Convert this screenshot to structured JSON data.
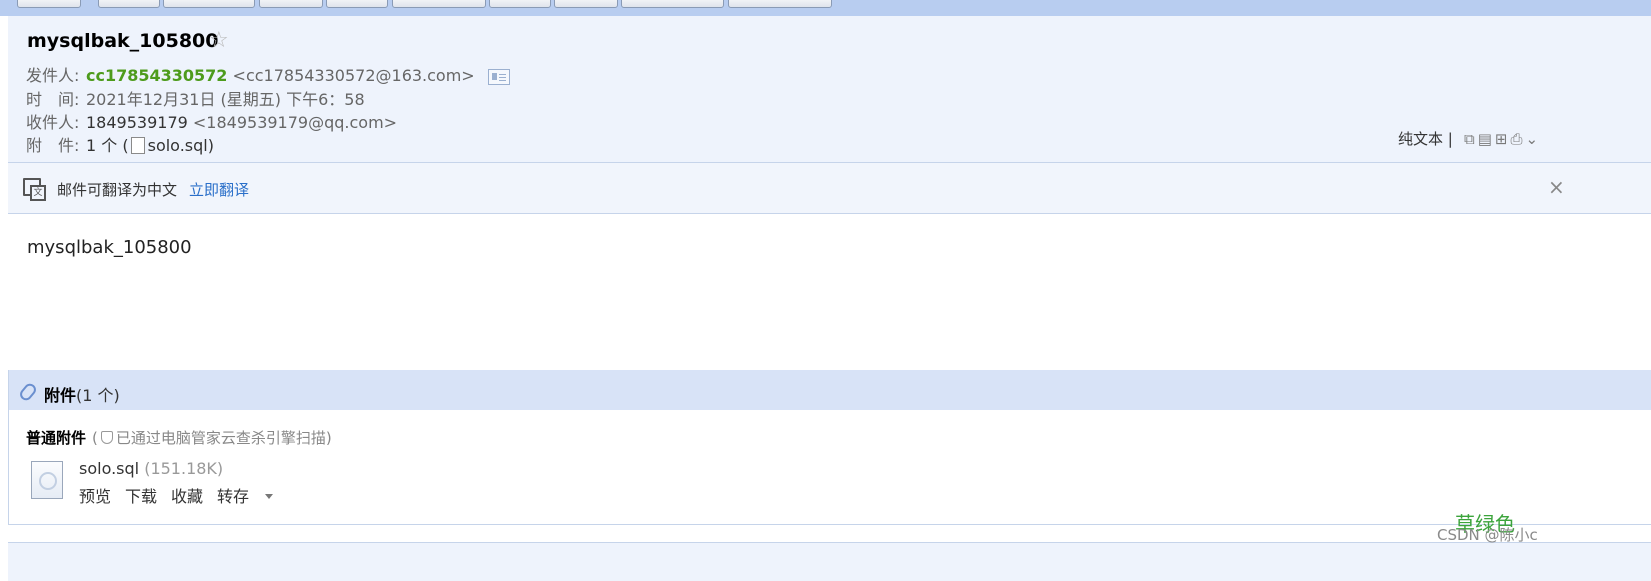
{
  "email": {
    "subject": "mysqlbak_105800",
    "sender": {
      "label": "发件人:",
      "name": "cc17854330572",
      "address": "<cc17854330572@163.com>"
    },
    "time": {
      "label": "时　间:",
      "value": "2021年12月31日 (星期五) 下午6：58"
    },
    "recipient": {
      "label": "收件人:",
      "name": "1849539179",
      "address": "<1849539179@qq.com>"
    },
    "attachment_row": {
      "label": "附　件:",
      "count_prefix": "1 个 (",
      "filename": "solo.sql",
      "suffix": ")"
    },
    "plain_text_label": "纯文本 |",
    "body": "mysqlbak_105800"
  },
  "translate": {
    "text": "邮件可翻译为中文",
    "link": "立即翻译",
    "close": "×"
  },
  "attachments": {
    "title": "附件",
    "count": "(1 个)",
    "normal_label": "普通附件",
    "scan_note_prefix": "(",
    "scan_note": "已通过电脑管家云查杀引擎扫描)",
    "file": {
      "name": "solo.sql",
      "size": "(151.18K)",
      "actions": [
        "预览",
        "下载",
        "收藏",
        "转存"
      ]
    }
  },
  "overlay": {
    "color_label": "草绿色",
    "watermark": "CSDN @陈小c"
  },
  "colors": {
    "accent_link": "#2a6fc9",
    "sender_green": "#4d9b1c",
    "toolbar": "#b8cdf0",
    "header_bg": "#eef3fc"
  }
}
